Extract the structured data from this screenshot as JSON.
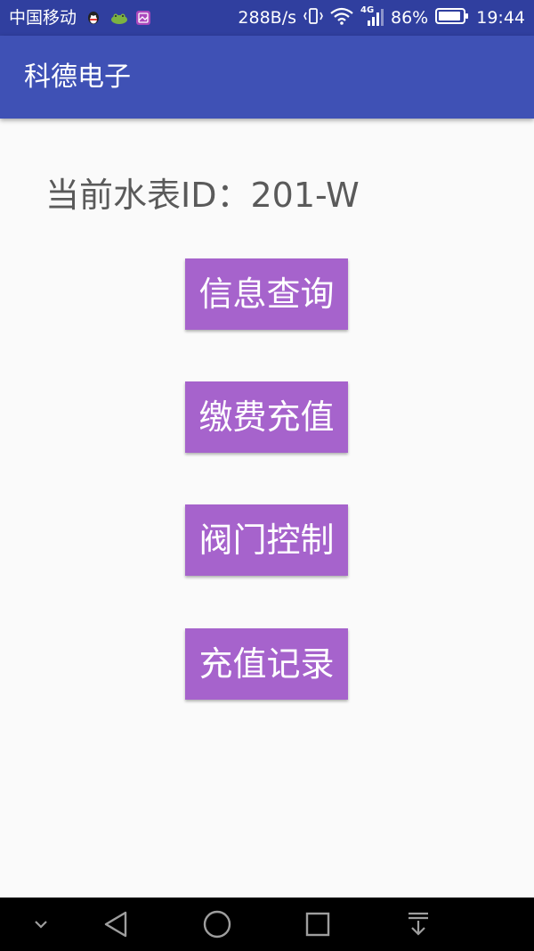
{
  "status_bar": {
    "carrier": "中国移动",
    "net_speed": "288B/s",
    "network_type": "4G",
    "battery_percent": "86%",
    "time": "19:44",
    "notification_icons": [
      "qq-icon",
      "frog-app-icon",
      "gallery-icon"
    ],
    "icons": [
      "vibrate-icon",
      "wifi-icon",
      "signal-icon",
      "battery-icon"
    ]
  },
  "app_bar": {
    "title": "科德电子"
  },
  "main": {
    "meter_label": "当前水表ID：",
    "meter_id": "201-W",
    "buttons": [
      {
        "label": "信息查询"
      },
      {
        "label": "缴费充值"
      },
      {
        "label": "阀门控制"
      },
      {
        "label": "充值记录"
      }
    ]
  },
  "nav_bar": {
    "icons": [
      "collapse-icon",
      "back-icon",
      "home-icon",
      "recents-icon",
      "notification-pull-icon"
    ]
  },
  "colors": {
    "status_bar": "#303f9f",
    "app_bar": "#3f51b5",
    "button": "#a663cc",
    "background": "#fafafa"
  }
}
